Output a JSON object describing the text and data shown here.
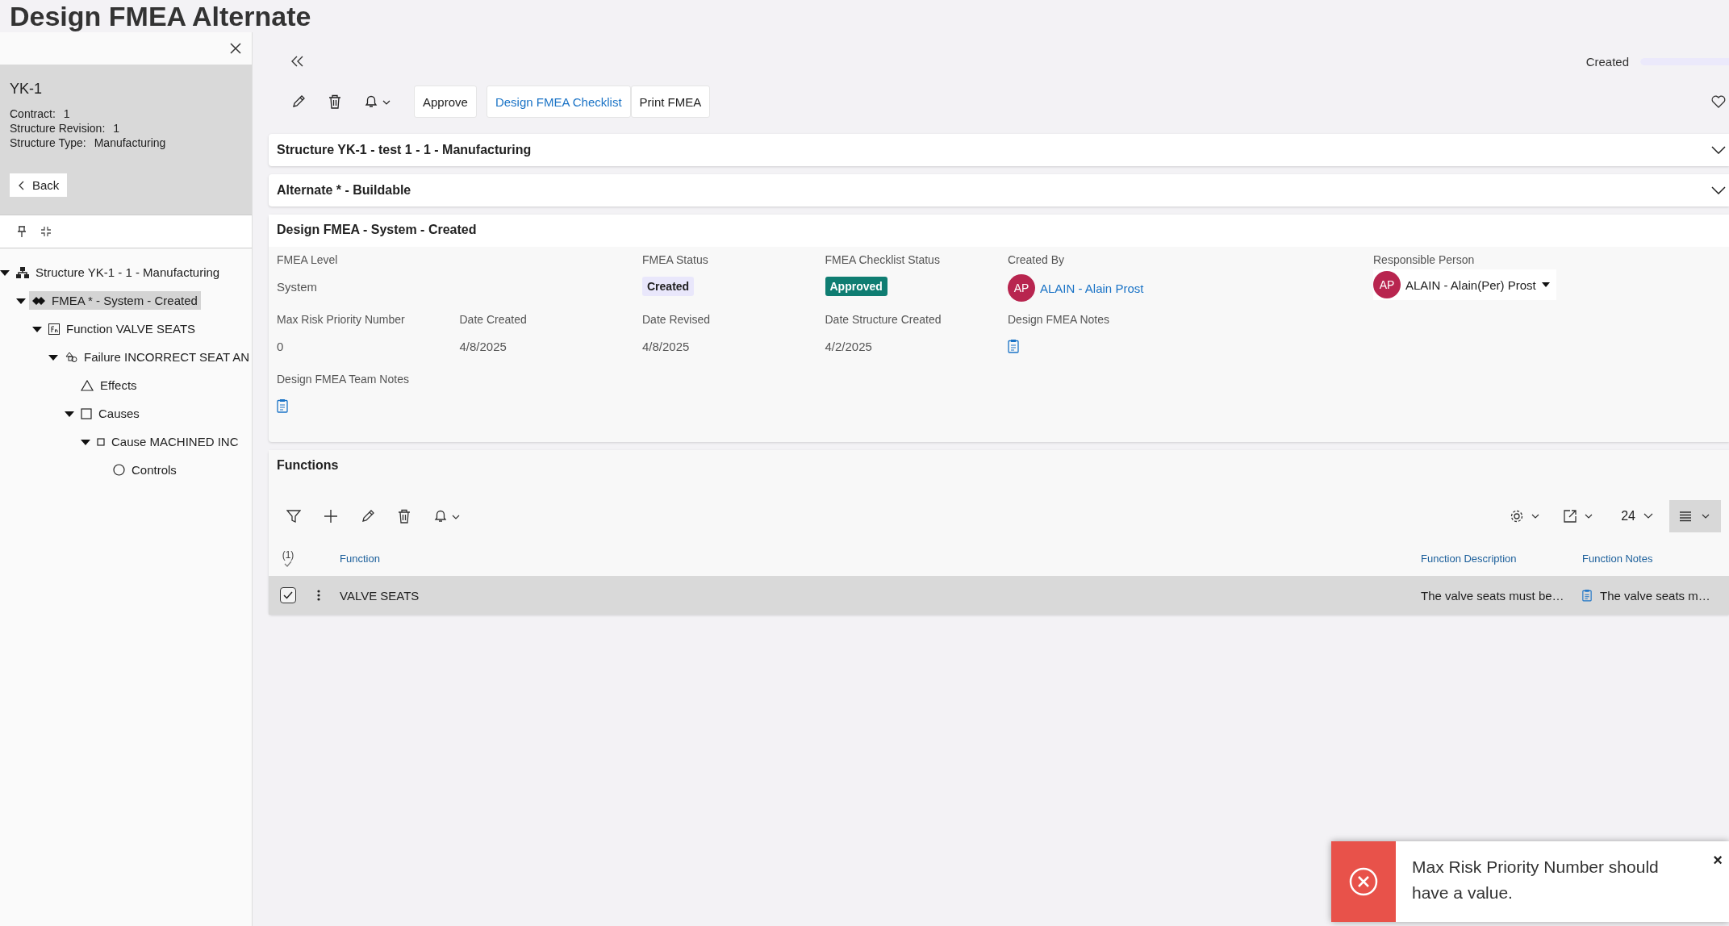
{
  "page_title": "Design FMEA Alternate",
  "side_panel": {
    "title": "YK-1",
    "fields": [
      {
        "label": "Contract:",
        "value": "1"
      },
      {
        "label": "Structure Revision:",
        "value": "1"
      },
      {
        "label": "Structure Type:",
        "value": "Manufacturing"
      }
    ],
    "back_button": "Back",
    "tree": [
      {
        "kind": "structure",
        "label": "Structure YK-1 - 1 - Manufacturing",
        "expanded": true,
        "selected": false,
        "children": [
          {
            "kind": "fmea",
            "label": "FMEA * - System - Created",
            "expanded": true,
            "selected": true,
            "children": [
              {
                "kind": "function",
                "label": "Function VALVE SEATS",
                "expanded": true,
                "selected": false,
                "children": [
                  {
                    "kind": "failure",
                    "label": "Failure INCORRECT SEAT AN",
                    "expanded": true,
                    "selected": false,
                    "children": [
                      {
                        "kind": "effects",
                        "label": "Effects",
                        "selected": false
                      },
                      {
                        "kind": "causes",
                        "label": "Causes",
                        "expanded": true,
                        "selected": false,
                        "children": [
                          {
                            "kind": "cause",
                            "label": "Cause MACHINED INC",
                            "expanded": true,
                            "selected": false,
                            "children": [
                              {
                                "kind": "controls",
                                "label": "Controls",
                                "selected": false
                              }
                            ]
                          }
                        ]
                      }
                    ]
                  }
                ]
              }
            ]
          }
        ]
      }
    ]
  },
  "header": {
    "status": "Created",
    "level": 1
  },
  "toolbar": {
    "buttons": [
      {
        "label": "Approve",
        "kind": "plain"
      },
      {
        "label": "Design FMEA Checklist",
        "kind": "link"
      },
      {
        "label": "Print FMEA",
        "kind": "plain"
      }
    ]
  },
  "sections": [
    {
      "title": "Structure YK-1 - test 1 - 1 - Manufacturing",
      "expanded": false
    },
    {
      "title": "Alternate * - Buildable",
      "expanded": false
    }
  ],
  "details": {
    "title": "Design FMEA - System - Created",
    "rows": [
      [
        {
          "kind": "text",
          "label": "FMEA Level",
          "value": "System"
        },
        "",
        {
          "kind": "badge",
          "label": "FMEA Status",
          "value": "Created",
          "color": "#e9e7fb"
        },
        {
          "kind": "badge",
          "label": "FMEA Checklist Status",
          "value": "Approved",
          "color": "#0f7d72"
        },
        {
          "kind": "person",
          "label": "Created By",
          "initials": "AP",
          "value": "ALAIN - Alain Prost"
        },
        "",
        {
          "kind": "select",
          "label": "Responsible Person",
          "initials": "AP",
          "value": "ALAIN - Alain(Per) Prost"
        }
      ],
      [
        {
          "kind": "text",
          "label": "Max Risk Priority Number",
          "value": "0"
        },
        {
          "kind": "text",
          "label": "Date Created",
          "value": "4/8/2025"
        },
        {
          "kind": "text",
          "label": "Date Revised",
          "value": "4/8/2025"
        },
        {
          "kind": "text",
          "label": "Date Structure Created",
          "value": "4/2/2025"
        },
        {
          "kind": "notes",
          "label": "Design FMEA Notes"
        }
      ],
      [
        {
          "kind": "notes",
          "label": "Design FMEA Team Notes"
        }
      ]
    ]
  },
  "functions": {
    "title": "Functions",
    "page_size": "24",
    "selected_count": "(1)",
    "columns": [
      "Function",
      "Function Description",
      "Function Notes"
    ],
    "rows": [
      {
        "selected": true,
        "function": "VALVE SEATS",
        "description": "The valve seats must be…",
        "notes": "The valve seats m…"
      }
    ]
  },
  "toast": {
    "kind": "error",
    "message": "Max Risk Priority Number should have a value.",
    "close": "×"
  }
}
